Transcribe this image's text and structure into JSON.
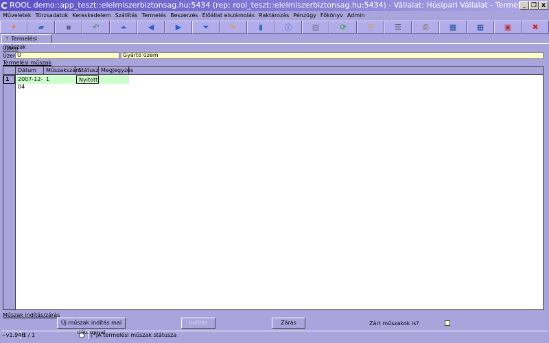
{
  "window": {
    "title": "ROOL demo::app_teszt::elelmiszerbiztonsag.hu:5434 (rep: rool_teszt::elelmiszerbiztonsag.hu:5434) - Vállalat: Húsipari Vállalat - Termelési mű...",
    "minimize": "_",
    "restore": "❐",
    "close": "x"
  },
  "menu": [
    "Műveletek",
    "Törzsadatok",
    "Kereskedelem",
    "Szállítás",
    "Termelés",
    "Beszerzés",
    "Élőállat elszámolás",
    "Raktározás",
    "Pénzügy",
    "Főkönyv",
    "Admin"
  ],
  "toolbar": [
    {
      "icon": "new-icon",
      "glyph": "✦",
      "color": "#e08020"
    },
    {
      "icon": "open-icon",
      "glyph": "▰",
      "color": "#3070c0"
    },
    {
      "icon": "save-icon",
      "glyph": "▪",
      "color": "#606080"
    },
    {
      "icon": "undo-icon",
      "glyph": "↶",
      "color": "#20a020"
    },
    {
      "icon": "first-icon",
      "glyph": "⏶",
      "color": "#2060d0"
    },
    {
      "icon": "prev-icon",
      "glyph": "◀",
      "color": "#2060d0"
    },
    {
      "icon": "next-icon",
      "glyph": "▶",
      "color": "#2060d0"
    },
    {
      "icon": "last-icon",
      "glyph": "⏷",
      "color": "#2060d0"
    },
    {
      "icon": "edit-icon",
      "glyph": "✎",
      "color": "#e0a020"
    },
    {
      "icon": "delete-icon",
      "glyph": "▮",
      "color": "#3070c0"
    },
    {
      "icon": "info-icon",
      "glyph": "ⓘ",
      "color": "#2060d0"
    },
    {
      "icon": "form-icon",
      "glyph": "▤",
      "color": "#707070"
    },
    {
      "icon": "refresh-icon",
      "glyph": "⟳",
      "color": "#20a020"
    },
    {
      "icon": "search-icon",
      "glyph": "⚲",
      "color": "#d0a020"
    },
    {
      "icon": "list-icon",
      "glyph": "☰",
      "color": "#505050"
    },
    {
      "icon": "print-icon",
      "glyph": "⎙",
      "color": "#806020"
    },
    {
      "icon": "export-icon",
      "glyph": "▦",
      "color": "#2050a0"
    },
    {
      "icon": "import-icon",
      "glyph": "▦",
      "color": "#2050a0"
    },
    {
      "icon": "layout-icon",
      "glyph": "▣",
      "color": "#c03030"
    },
    {
      "icon": "exit-icon",
      "glyph": "✖",
      "color": "#e02020"
    }
  ],
  "tab": {
    "label": "Termelési műszak"
  },
  "uzem": {
    "section": "Üzem",
    "label": "Üzem",
    "code": "U",
    "name": "Gyártó üzem"
  },
  "grid": {
    "section": "Termelési műszak",
    "columns": [
      "Dátum",
      "Műszakszám",
      "Státusz",
      "Megjegyzés"
    ],
    "rows": [
      {
        "num": "1",
        "datum": "2007-12-04",
        "muszakszam": "1",
        "statusz": "Nyitott",
        "megjegyzes": ""
      }
    ]
  },
  "bottom": {
    "section": "Műszak indítás/zárás",
    "new_button": "Új műszak indítás mai dátummal",
    "start_button": "Indítás",
    "close_button": "Zárás",
    "closed_label": "Zárt műszakok is?",
    "closed_checked": false
  },
  "status": {
    "version": "~v1.94H",
    "record": "1 / 1",
    "hint": "(*)A termelési műszak státusza"
  }
}
